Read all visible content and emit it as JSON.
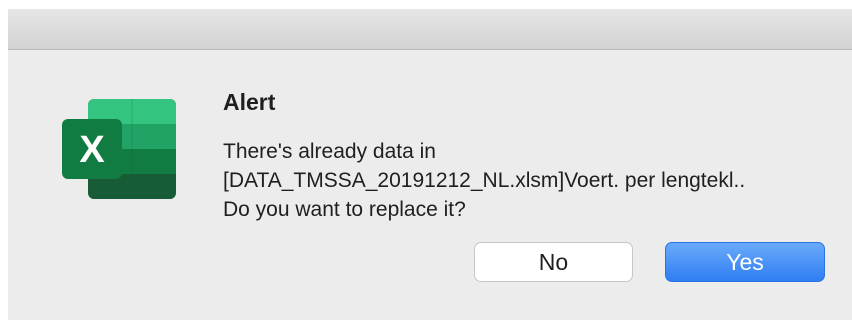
{
  "window": {
    "app_icon": "excel-icon"
  },
  "alert": {
    "title": "Alert",
    "message_lines": [
      "There's already data in",
      "[DATA_TMSSA_20191212_NL.xlsm]Voert. per lengtekl..",
      "Do you want to replace it?"
    ]
  },
  "buttons": {
    "no_label": "No",
    "yes_label": "Yes"
  },
  "colors": {
    "default_button": "#2f7ef3",
    "excel_green": "#1e7145"
  }
}
